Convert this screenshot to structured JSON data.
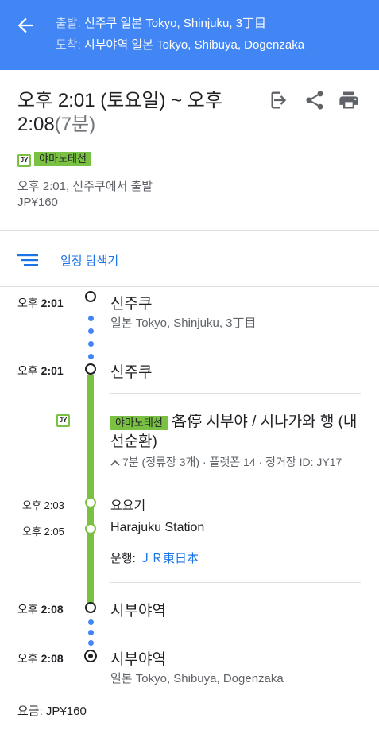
{
  "header": {
    "origin_label": "출발:",
    "origin": "신주쿠 일본 Tokyo, Shinjuku, 3丁目",
    "destination_label": "도착:",
    "destination": "시부야역 일본 Tokyo, Shibuya, Dogenzaka",
    "colors": {
      "background": "#4285f4"
    }
  },
  "summary": {
    "time_range": "오후 2:01 (토요일) ~ 오후 2:08",
    "duration": "(7분)",
    "line_badge": "JY",
    "line_name": "야마노테선",
    "departure_text": "오후 2:01, 신주쿠에서 출발",
    "fare": "JP¥160"
  },
  "toolbar": {
    "icons": [
      "sign-in-icon",
      "share-icon",
      "print-icon"
    ]
  },
  "explorer": {
    "label": "일정 탐색기",
    "icon": "list-icon"
  },
  "timeline": {
    "origin_time_prefix": "오후",
    "origin_time": "2:01",
    "origin_station": "신주쿠",
    "origin_address": "일본 Tokyo, Shinjuku, 3丁目",
    "board_time_prefix": "오후",
    "board_time": "2:01",
    "board_station": "신주쿠",
    "line_badge": "JY",
    "line_name": "야마노테선",
    "route_headsign": "各停 시부야 / 시나가와 행 (내선순환)",
    "route_info": "7분 (정류장 3개) · 플랫폼 14 · 정거장 ID: JY17",
    "stops": [
      {
        "time": "오후 2:03",
        "name": "요요기"
      },
      {
        "time": "오후 2:05",
        "name": "Harajuku Station"
      }
    ],
    "operator_label": "운행:",
    "operator_name": "ＪＲ東日本",
    "alight_time_prefix": "오후",
    "alight_time": "2:08",
    "alight_station": "시부야역",
    "dest_time_prefix": "오후",
    "dest_time": "2:08",
    "dest_station": "시부야역",
    "dest_address": "일본 Tokyo, Shibuya, Dogenzaka",
    "fare_text": "요금: JP¥160",
    "colors": {
      "line": "#7ac143",
      "walk": "#4285f4"
    }
  }
}
